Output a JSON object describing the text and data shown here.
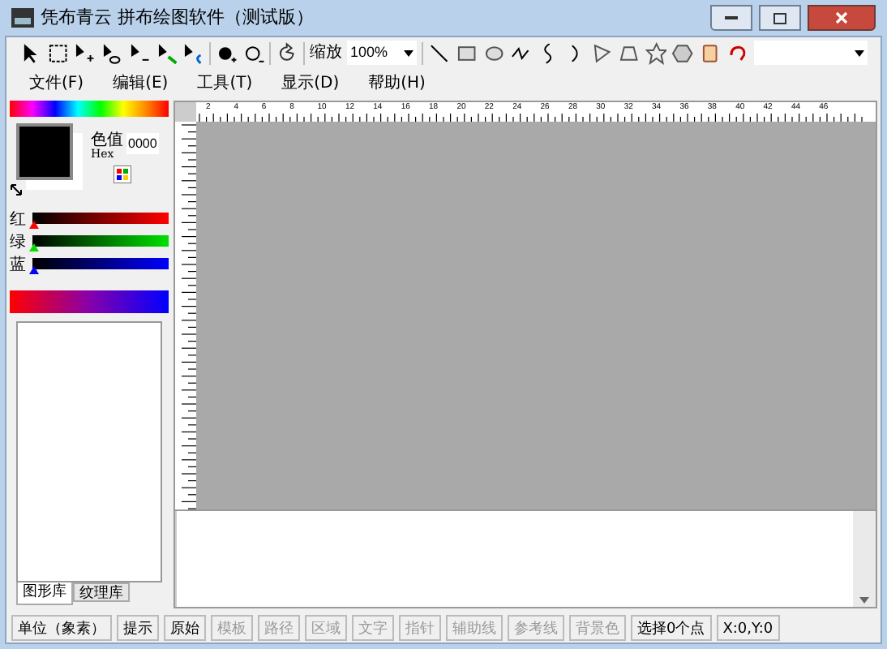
{
  "window": {
    "title": "凭布青云 拼布绘图软件（测试版）"
  },
  "toolbar": {
    "zoom_label": "缩放",
    "zoom_value": "100%"
  },
  "menu": [
    {
      "label": "文件(F)"
    },
    {
      "label": "编辑(E)"
    },
    {
      "label": "工具(T)"
    },
    {
      "label": "显示(D)"
    },
    {
      "label": "帮助(H)"
    }
  ],
  "color_panel": {
    "value_label": "色值",
    "hex_label": "Hex",
    "hex_value": "0000",
    "sliders": [
      {
        "label": "红",
        "level": 0
      },
      {
        "label": "绿",
        "level": 0
      },
      {
        "label": "蓝",
        "level": 0
      }
    ]
  },
  "library_tabs": [
    {
      "label": "图形库",
      "selected": true
    },
    {
      "label": "纹理库",
      "selected": false
    }
  ],
  "ruler": {
    "labels": [
      "2",
      "4",
      "6",
      "8",
      "10",
      "12",
      "14",
      "16",
      "18",
      "20",
      "22",
      "24",
      "26",
      "28",
      "30",
      "32",
      "34",
      "36",
      "38",
      "40",
      "42",
      "44",
      "46"
    ]
  },
  "status_bar": [
    {
      "label": "单位（象素）",
      "disabled": false
    },
    {
      "label": "提示",
      "disabled": false
    },
    {
      "label": "原始",
      "disabled": false
    },
    {
      "label": "模板",
      "disabled": true
    },
    {
      "label": "路径",
      "disabled": true
    },
    {
      "label": "区域",
      "disabled": true
    },
    {
      "label": "文字",
      "disabled": true
    },
    {
      "label": "指针",
      "disabled": true
    },
    {
      "label": "辅助线",
      "disabled": true
    },
    {
      "label": "参考线",
      "disabled": true
    },
    {
      "label": "背景色",
      "disabled": true
    },
    {
      "label": "选择0个点",
      "disabled": false
    },
    {
      "label": "X:0,Y:0",
      "disabled": false
    }
  ]
}
